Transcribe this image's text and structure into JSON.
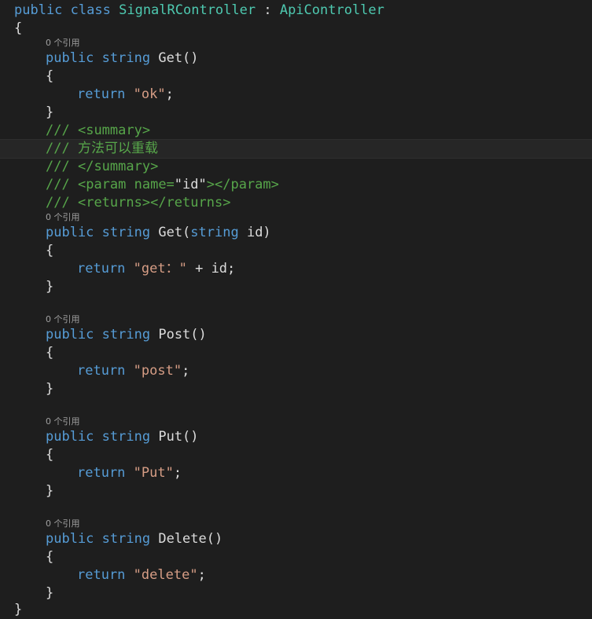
{
  "code": {
    "l1": {
      "kw_public": "public",
      "kw_class": "class",
      "class_name": "SignalRController",
      "colon": " : ",
      "base": "ApiController"
    },
    "brace_open": "{",
    "brace_close": "}",
    "ref_label": "0 个引用",
    "m1": {
      "kw_public": "public",
      "kw_string": "string",
      "name": "Get()",
      "kw_return": "return",
      "str": "\"ok\"",
      "semi": ";"
    },
    "doc": {
      "slashes": "///",
      "summary_open": "<summary>",
      "summary_text": "方法可以重载",
      "summary_close": "</summary>",
      "param_open": "<param name=",
      "param_value": "\"id\"",
      "param_close": "></param>",
      "returns": "<returns></returns>"
    },
    "m2": {
      "kw_public": "public",
      "kw_string": "string",
      "name_pre": "Get(",
      "kw_param_type": "string",
      "param": " id)",
      "kw_return": "return",
      "str": "\"get：\"",
      "rest": " + id;"
    },
    "m3": {
      "kw_public": "public",
      "kw_string": "string",
      "name": "Post()",
      "kw_return": "return",
      "str": "\"post\"",
      "semi": ";"
    },
    "m4": {
      "kw_public": "public",
      "kw_string": "string",
      "name": "Put()",
      "kw_return": "return",
      "str": "\"Put\"",
      "semi": ";"
    },
    "m5": {
      "kw_public": "public",
      "kw_string": "string",
      "name": "Delete()",
      "kw_return": "return",
      "str": "\"delete\"",
      "semi": ";"
    }
  },
  "colors": {
    "background": "#1e1e1e",
    "keyword": "#569cd6",
    "type": "#4ec9b0",
    "string": "#d69d85",
    "comment": "#57a64a",
    "text": "#dcdcdc"
  }
}
